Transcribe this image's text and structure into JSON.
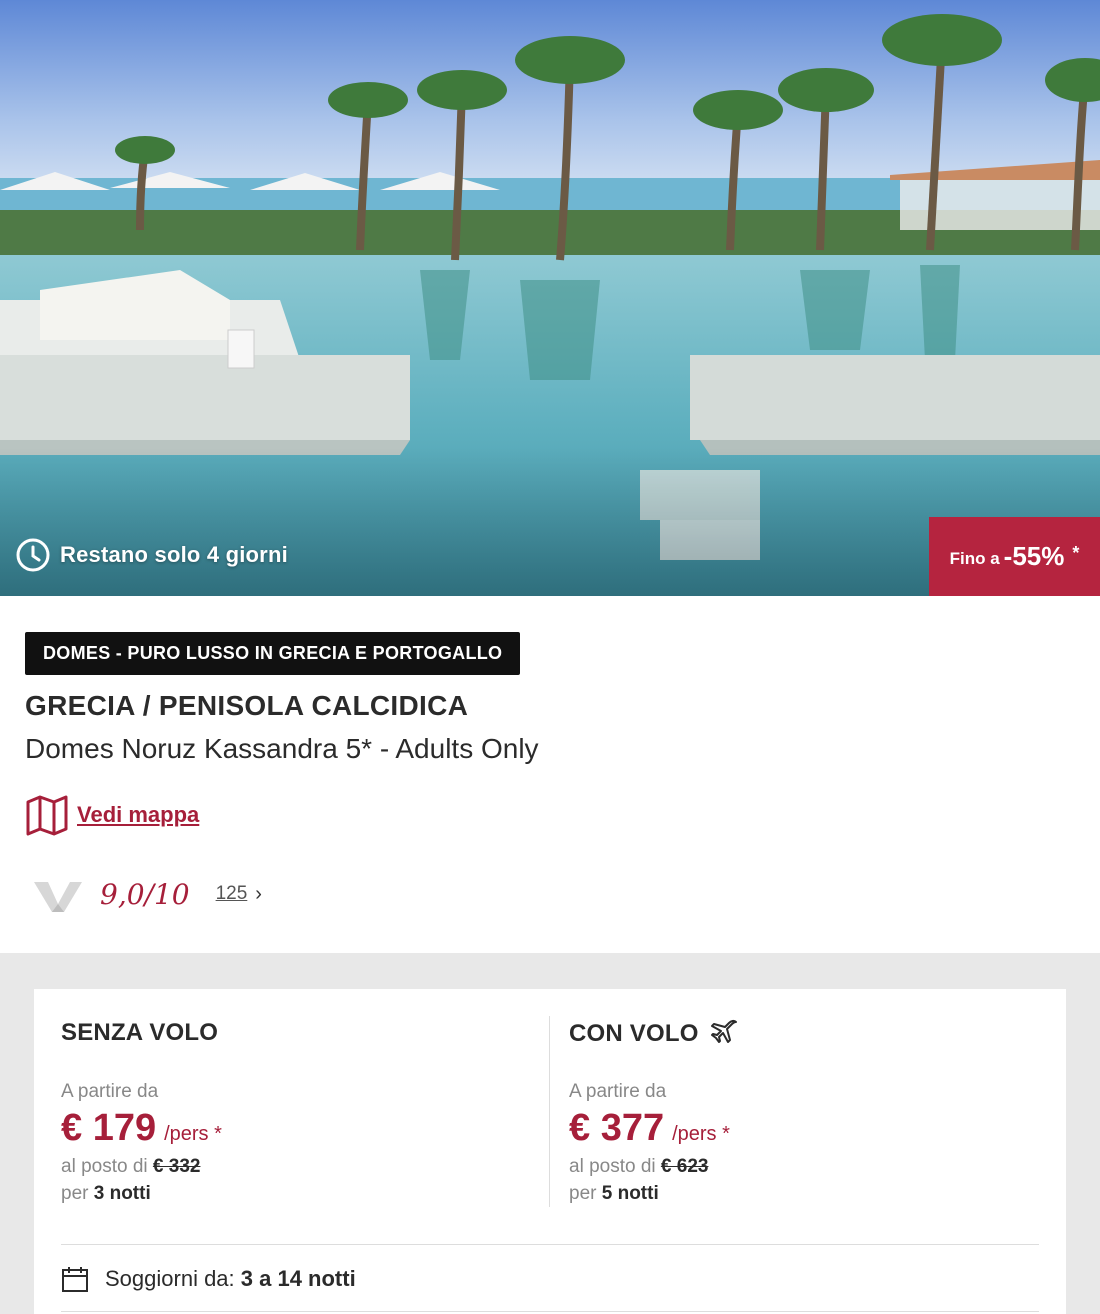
{
  "hero": {
    "timer_text": "Restano solo 4 giorni",
    "discount_prefix": "Fino a",
    "discount_value": "-55%",
    "discount_asterisk": "*"
  },
  "offer": {
    "tag": "DOMES - PURO LUSSO IN GRECIA E PORTOGALLO",
    "region": "GRECIA / PENISOLA CALCIDICA",
    "hotel_name": "Domes Noruz Kassandra 5* - Adults Only",
    "map_link": "Vedi mappa"
  },
  "rating": {
    "score": "9,0/10",
    "reviews_count": "125",
    "chevron": "›"
  },
  "pricing": {
    "without_flight": {
      "title": "SENZA VOLO",
      "from_label": "A partire da",
      "price": "€ 179",
      "per": "/pers *",
      "instead_label": "al posto di",
      "old_price": "€ 332",
      "per_label": "per",
      "nights": "3 notti"
    },
    "with_flight": {
      "title": "CON VOLO",
      "from_label": "A partire da",
      "price": "€ 377",
      "per": "/pers *",
      "instead_label": "al posto di",
      "old_price": "€ 623",
      "per_label": "per",
      "nights": "5 notti"
    },
    "stay": {
      "label": "Soggiorni da:",
      "value": "3 a 14 notti"
    }
  },
  "colors": {
    "accent": "#a61f3a",
    "discount_bg": "#b5243f",
    "tag_bg": "#111111",
    "panel_bg": "#e8e8e8"
  },
  "icons": {
    "timer": "clock-icon",
    "map": "map-icon",
    "flight": "plane-icon",
    "calendar": "calendar-icon",
    "rating_logo": "rating-logo-icon"
  }
}
